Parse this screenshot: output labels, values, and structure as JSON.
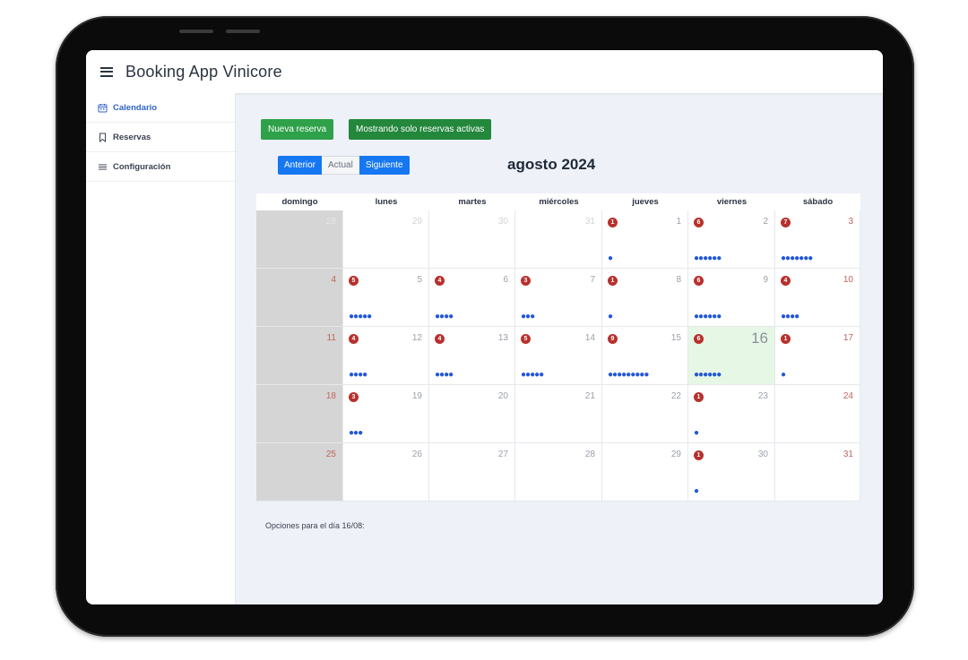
{
  "header": {
    "title": "Booking App Vinicore"
  },
  "sidebar": {
    "items": [
      {
        "label": "Calendario",
        "icon": "calendar-icon",
        "active": true
      },
      {
        "label": "Reservas",
        "icon": "bookmark-icon",
        "active": false
      },
      {
        "label": "Configuración",
        "icon": "list-icon",
        "active": false
      }
    ]
  },
  "toolbar": {
    "new_label": "Nueva reserva",
    "filter_label": "Mostrando solo reservas activas"
  },
  "nav": {
    "prev": "Anterior",
    "current": "Actual",
    "next": "Siguiente"
  },
  "month_title": "agosto 2024",
  "weekdays": [
    "domingo",
    "lunes",
    "martes",
    "miércoles",
    "jueves",
    "viernes",
    "sábado"
  ],
  "weeks": [
    [
      {
        "day": "28",
        "faded": true
      },
      {
        "day": "29",
        "faded": true
      },
      {
        "day": "30",
        "faded": true
      },
      {
        "day": "31",
        "faded": true
      },
      {
        "day": "1",
        "badge": "1",
        "dots": 1
      },
      {
        "day": "2",
        "badge": "6",
        "dots": 6
      },
      {
        "day": "3",
        "badge": "7",
        "dots": 7
      }
    ],
    [
      {
        "day": "4"
      },
      {
        "day": "5",
        "badge": "5",
        "dots": 5
      },
      {
        "day": "6",
        "badge": "4",
        "dots": 4
      },
      {
        "day": "7",
        "badge": "3",
        "dots": 3
      },
      {
        "day": "8",
        "badge": "1",
        "dots": 1
      },
      {
        "day": "9",
        "badge": "6",
        "dots": 6
      },
      {
        "day": "10",
        "badge": "4",
        "dots": 4
      }
    ],
    [
      {
        "day": "11"
      },
      {
        "day": "12",
        "badge": "4",
        "dots": 4
      },
      {
        "day": "13",
        "badge": "4",
        "dots": 4
      },
      {
        "day": "14",
        "badge": "5",
        "dots": 5
      },
      {
        "day": "15",
        "badge": "9",
        "dots": 9
      },
      {
        "day": "16",
        "badge": "6",
        "dots": 6,
        "today": true
      },
      {
        "day": "17",
        "badge": "1",
        "dots": 1
      }
    ],
    [
      {
        "day": "18"
      },
      {
        "day": "19",
        "badge": "3",
        "dots": 3
      },
      {
        "day": "20"
      },
      {
        "day": "21"
      },
      {
        "day": "22"
      },
      {
        "day": "23",
        "badge": "1",
        "dots": 1
      },
      {
        "day": "24"
      }
    ],
    [
      {
        "day": "25"
      },
      {
        "day": "26"
      },
      {
        "day": "27"
      },
      {
        "day": "28"
      },
      {
        "day": "29"
      },
      {
        "day": "30",
        "badge": "1",
        "dots": 1
      },
      {
        "day": "31"
      }
    ]
  ],
  "options_text": "Opciones para el día 16/08:",
  "colors": {
    "accent_blue": "#1677f2",
    "green": "#2fa14a",
    "badge_red": "#b8302c",
    "dot_blue": "#2257d8",
    "today_bg": "#e6f7e6",
    "weekend_red": "#c0645e"
  }
}
